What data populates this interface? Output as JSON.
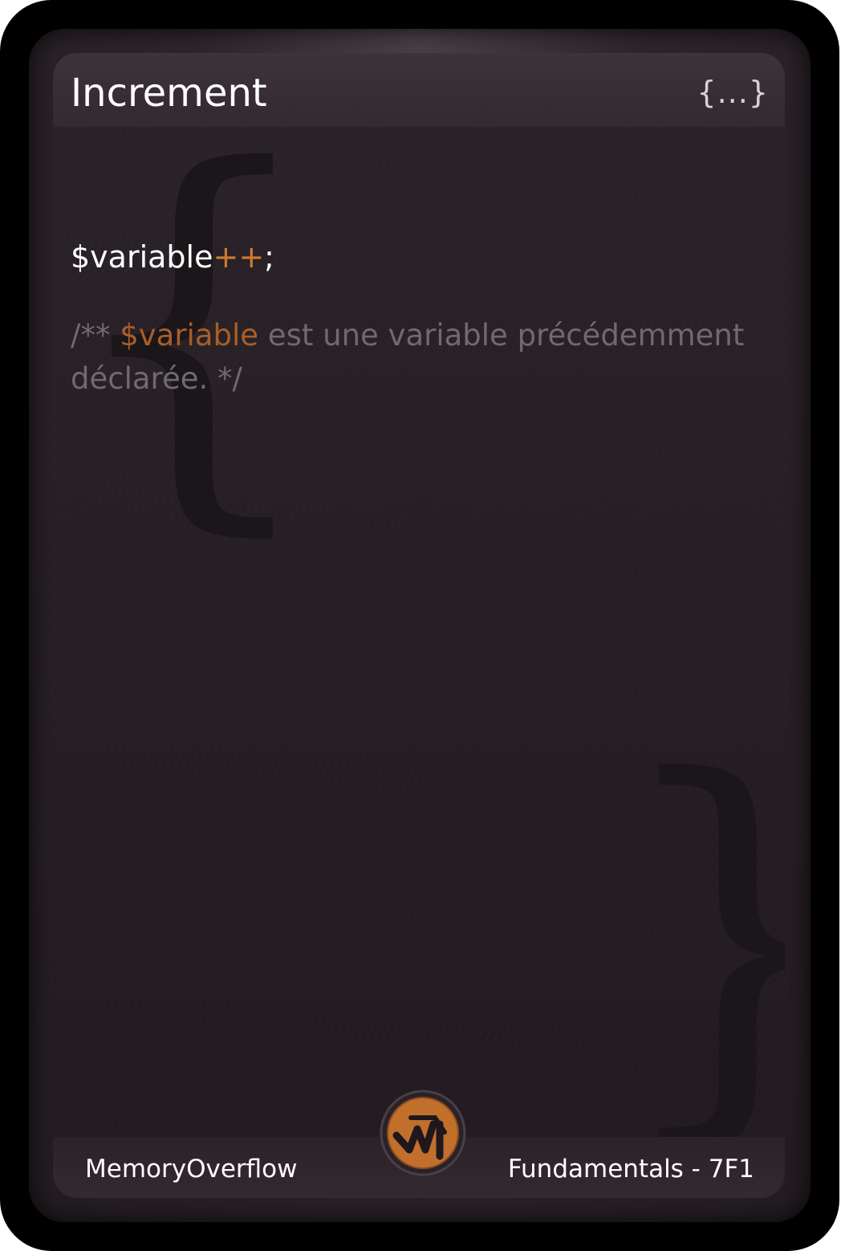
{
  "card": {
    "title": "Increment",
    "badge": "{...}",
    "code": {
      "variable": "$variable",
      "operator": "++",
      "terminator": ";"
    },
    "comment": {
      "open": "/** ",
      "variable": "$variable",
      "text": " est une variable précédemment déclarée. */"
    },
    "footer": {
      "left": "MemoryOverflow",
      "right": "Fundamentals - 7F1"
    },
    "logo_icon": "memoryoverflow-logo-icon",
    "colors": {
      "accent": "#d07a32",
      "comment": "#6f6a70",
      "background": "#231c22",
      "border": "#000000"
    }
  }
}
